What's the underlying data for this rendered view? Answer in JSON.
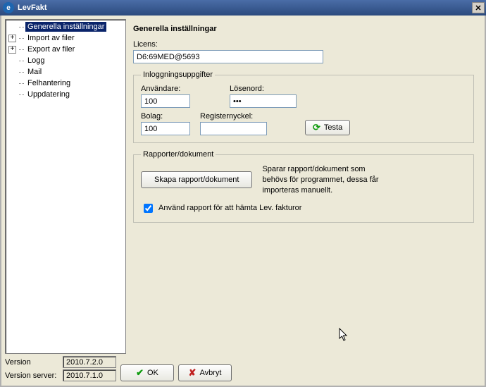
{
  "title": "LevFakt",
  "tree": {
    "items": [
      {
        "label": "Generella inställningar",
        "expandable": false,
        "selected": true
      },
      {
        "label": "Import av filer",
        "expandable": true
      },
      {
        "label": "Export av filer",
        "expandable": true
      },
      {
        "label": "Logg",
        "expandable": false
      },
      {
        "label": "Mail",
        "expandable": false
      },
      {
        "label": "Felhantering",
        "expandable": false
      },
      {
        "label": "Uppdatering",
        "expandable": false
      }
    ]
  },
  "content": {
    "heading": "Generella inställningar",
    "licens_label": "Licens:",
    "licens_value": "D6:69MED@5693",
    "inloggning": {
      "legend": "Inloggningsuppgifter",
      "anvandare_label": "Användare:",
      "anvandare_value": "100",
      "losenord_label": "Lösenord:",
      "losenord_value": "xxx",
      "bolag_label": "Bolag:",
      "bolag_value": "100",
      "registernyckel_label": "Registernyckel:",
      "registernyckel_value": "",
      "testa_label": "Testa"
    },
    "rapporter": {
      "legend": "Rapporter/dokument",
      "skapa_label": "Skapa rapport/dokument",
      "help": "Sparar rapport/dokument som behövs för programmet, dessa får importeras manuellt.",
      "checkbox_label": "Använd rapport för att hämta Lev. fakturor",
      "checkbox_checked": true
    }
  },
  "footer": {
    "version_label": "Version",
    "version_value": "2010.7.2.0",
    "version_server_label": "Version server:",
    "version_server_value": "2010.7.1.0",
    "ok_label": "OK",
    "cancel_label": "Avbryt"
  }
}
